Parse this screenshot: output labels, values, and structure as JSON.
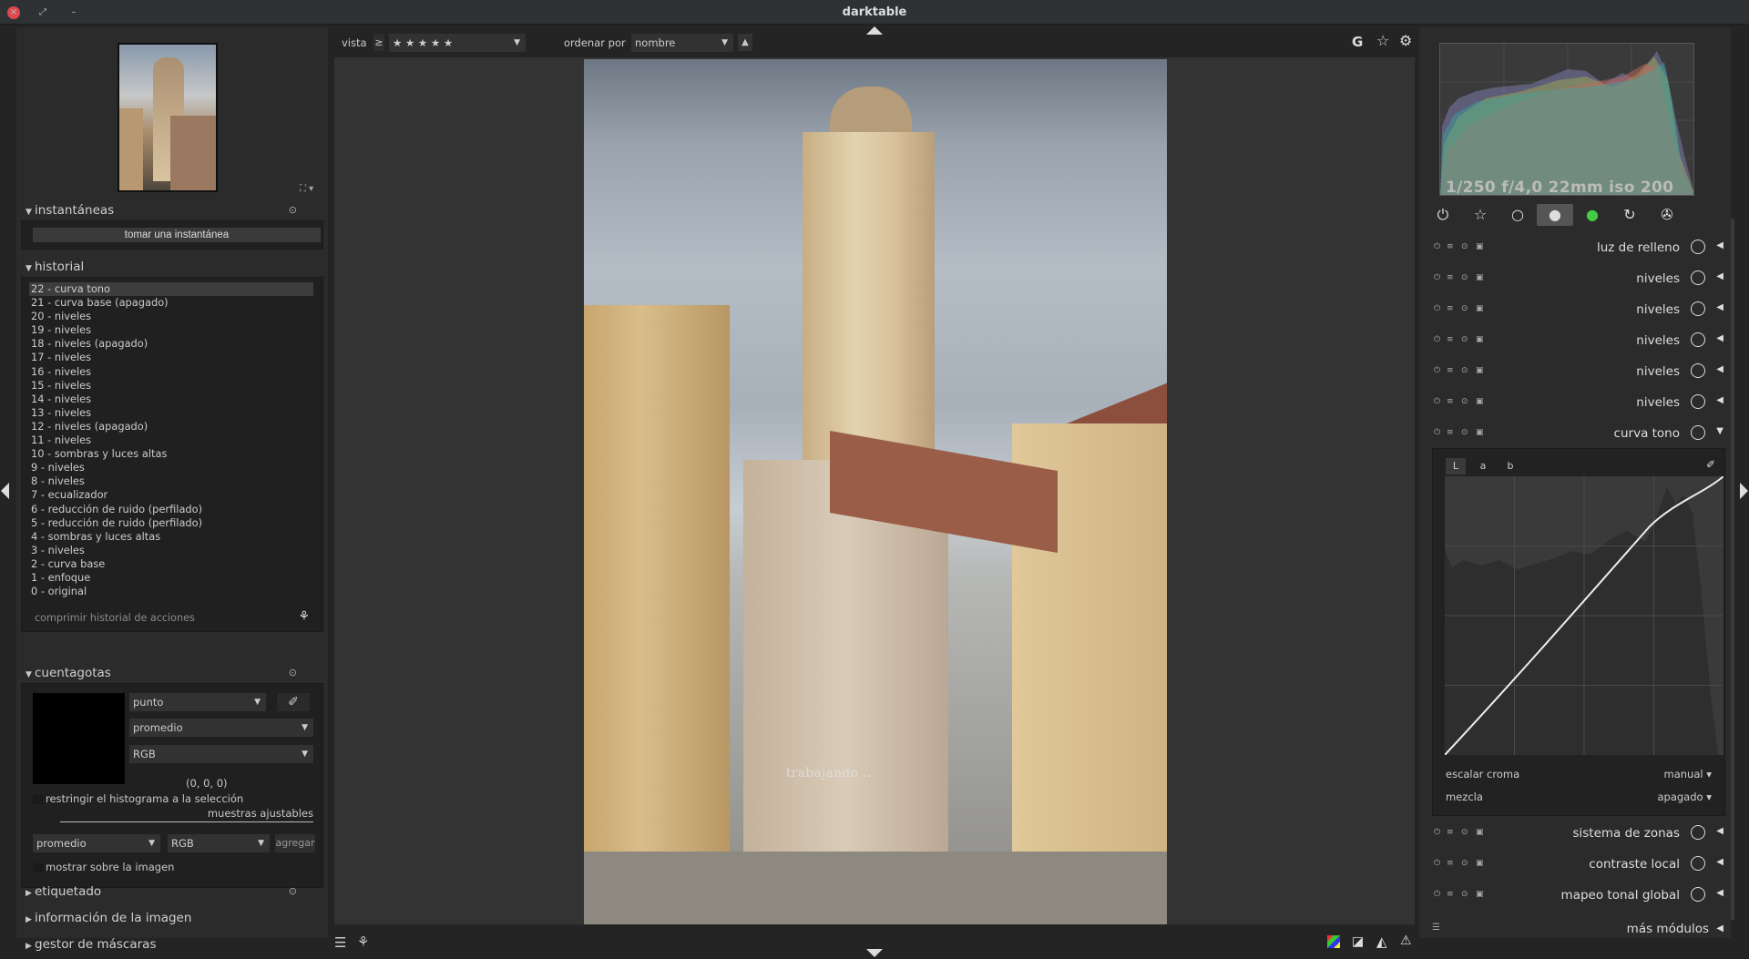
{
  "window": {
    "title": "darktable",
    "close_glyph": "×",
    "max_glyph": "⤢",
    "min_glyph": "–"
  },
  "left": {
    "zoom_ctrl": "⛶ ▾",
    "snapshots": {
      "title": "instantáneas",
      "button": "tomar una instantánea"
    },
    "history": {
      "title": "historial",
      "items": [
        "22 - curva tono",
        "21 - curva base (apagado)",
        "20 - niveles",
        "19 - niveles",
        "18 - niveles (apagado)",
        "17 - niveles",
        "16 - niveles",
        "15 - niveles",
        "14 - niveles",
        "13 - niveles",
        "12 - niveles (apagado)",
        "11 - niveles",
        "10 - sombras y luces altas",
        "9 - niveles",
        "8 - niveles",
        "7 - ecualizador",
        "6 - reducción de ruido (perfilado)",
        "5 - reducción de ruido (perfilado)",
        "4 - sombras y luces altas",
        "3 - niveles",
        "2 - curva base",
        "1 - enfoque",
        "0 - original"
      ],
      "compress": "comprimir historial de acciones"
    },
    "colorpicker": {
      "title": "cuentagotas",
      "mode": "punto",
      "statistic": "promedio",
      "model": "RGB",
      "value": "(0, 0, 0)",
      "restrict": "restringir el histograma a la selección",
      "samples": "muestras ajustables",
      "sample_stat": "promedio",
      "sample_model": "RGB",
      "add": "agregar",
      "show_on_image": "mostrar sobre la imagen"
    },
    "tagging": {
      "title": "etiquetado"
    },
    "imageinfo": {
      "title": "información de la imagen"
    },
    "masks": {
      "title": "gestor de máscaras"
    }
  },
  "center": {
    "view_label": "vista",
    "view_op": "≥",
    "rating": "★ ★ ★ ★ ★",
    "sort_label": "ordenar por",
    "sort_value": "nombre",
    "sort_dir": "▲",
    "grouping": "G",
    "status": "trabajando .."
  },
  "right": {
    "exif": "1/250 f/4,0 22mm iso 200",
    "modules": [
      {
        "name": "luz de relleno"
      },
      {
        "name": "niveles"
      },
      {
        "name": "niveles"
      },
      {
        "name": "niveles"
      },
      {
        "name": "niveles"
      },
      {
        "name": "niveles"
      },
      {
        "name": "curva tono"
      }
    ],
    "tonecurve": {
      "tabs": [
        "L",
        "a",
        "b"
      ],
      "chroma_label": "escalar croma",
      "chroma_value": "manual ▾",
      "blend_label": "mezcla",
      "blend_value": "apagado ▾"
    },
    "modules_after": [
      {
        "name": "sistema de zonas"
      },
      {
        "name": "contraste local"
      },
      {
        "name": "mapeo tonal global"
      }
    ],
    "more_modules": "más módulos"
  },
  "colors": {
    "bg": "#242424",
    "panel": "#2b2b2b",
    "accent": "#e0484d"
  }
}
